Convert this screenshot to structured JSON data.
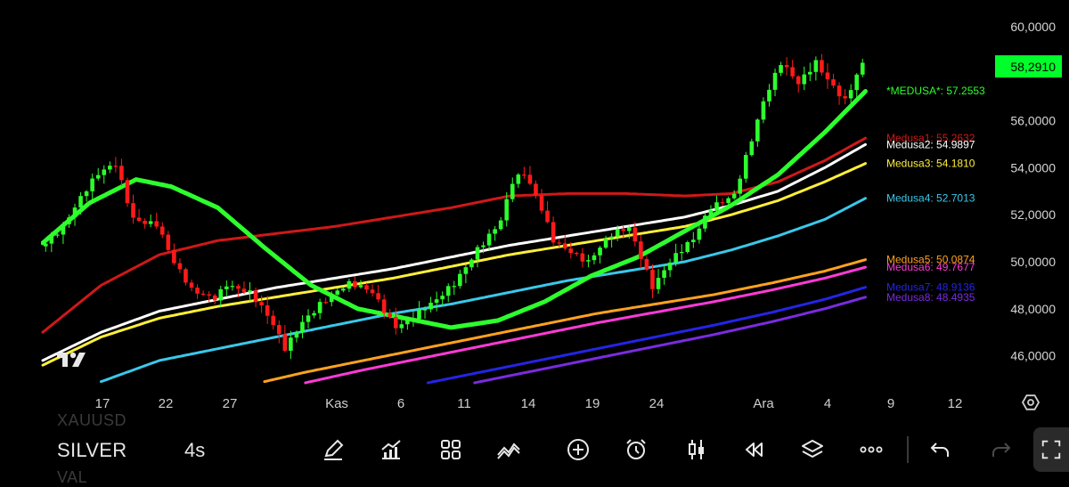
{
  "chart_data": {
    "type": "candlestick",
    "instrument": "SILVER",
    "ylim": [
      44.8,
      60.6
    ],
    "y_ticks": [
      "60,0000",
      "56,0000",
      "54,0000",
      "52,0000",
      "50,0000",
      "48,0000",
      "46,0000"
    ],
    "y_tick_values": [
      60,
      56,
      54,
      52,
      50,
      48,
      46
    ],
    "x_ticks": [
      "17",
      "22",
      "27",
      "Kas",
      "6",
      "11",
      "14",
      "19",
      "24",
      "Ara",
      "4",
      "9",
      "12"
    ],
    "current_price": {
      "label": "58,2910",
      "value": 58.291,
      "color": "#00ff2a"
    },
    "price_path": [
      {
        "bar": 0,
        "value": 50.8
      },
      {
        "bar": 4,
        "value": 51.6
      },
      {
        "bar": 10,
        "value": 53.6
      },
      {
        "bar": 13,
        "value": 54.2
      },
      {
        "bar": 16,
        "value": 52.0
      },
      {
        "bar": 20,
        "value": 51.6
      },
      {
        "bar": 23,
        "value": 49.8
      },
      {
        "bar": 26,
        "value": 48.7
      },
      {
        "bar": 30,
        "value": 48.6
      },
      {
        "bar": 32,
        "value": 49.2
      },
      {
        "bar": 36,
        "value": 48.6
      },
      {
        "bar": 40,
        "value": 47.2
      },
      {
        "bar": 42,
        "value": 46.3
      },
      {
        "bar": 45,
        "value": 47.6
      },
      {
        "bar": 48,
        "value": 48.3
      },
      {
        "bar": 53,
        "value": 48.9
      },
      {
        "bar": 57,
        "value": 48.7
      },
      {
        "bar": 61,
        "value": 47.4
      },
      {
        "bar": 64,
        "value": 47.7
      },
      {
        "bar": 68,
        "value": 48.2
      },
      {
        "bar": 71,
        "value": 49.0
      },
      {
        "bar": 75,
        "value": 50.7
      },
      {
        "bar": 79,
        "value": 51.8
      },
      {
        "bar": 81,
        "value": 53.3
      },
      {
        "bar": 83,
        "value": 53.6
      },
      {
        "bar": 86,
        "value": 52.2
      },
      {
        "bar": 88,
        "value": 51.0
      },
      {
        "bar": 91,
        "value": 50.6
      },
      {
        "bar": 94,
        "value": 50.0
      },
      {
        "bar": 98,
        "value": 51.0
      },
      {
        "bar": 101,
        "value": 51.4
      },
      {
        "bar": 103,
        "value": 50.3
      },
      {
        "bar": 105,
        "value": 49.1
      },
      {
        "bar": 108,
        "value": 50.1
      },
      {
        "bar": 112,
        "value": 50.8
      },
      {
        "bar": 115,
        "value": 52.2
      },
      {
        "bar": 119,
        "value": 53.0
      },
      {
        "bar": 121,
        "value": 54.6
      },
      {
        "bar": 124,
        "value": 56.8
      },
      {
        "bar": 127,
        "value": 58.3
      },
      {
        "bar": 130,
        "value": 57.5
      },
      {
        "bar": 133,
        "value": 58.6
      },
      {
        "bar": 136,
        "value": 57.6
      },
      {
        "bar": 138,
        "value": 56.9
      },
      {
        "bar": 141,
        "value": 58.3
      }
    ],
    "series": [
      {
        "name": "*MEDUSA*",
        "label": "*MEDUSA*: 57.2553",
        "last": 57.2553,
        "color": "#2dff2d",
        "points": [
          [
            0,
            50.8
          ],
          [
            8,
            52.5
          ],
          [
            16,
            53.5
          ],
          [
            22,
            53.2
          ],
          [
            30,
            52.3
          ],
          [
            38,
            50.6
          ],
          [
            46,
            49.0
          ],
          [
            54,
            48.0
          ],
          [
            62,
            47.6
          ],
          [
            70,
            47.2
          ],
          [
            78,
            47.5
          ],
          [
            86,
            48.3
          ],
          [
            94,
            49.4
          ],
          [
            102,
            50.2
          ],
          [
            110,
            51.3
          ],
          [
            118,
            52.4
          ],
          [
            126,
            53.7
          ],
          [
            134,
            55.5
          ],
          [
            141,
            57.2553
          ]
        ]
      },
      {
        "name": "Medusa1",
        "label": "Medusa1: 55.2632",
        "last": 55.2632,
        "color": "#d01818",
        "points": [
          [
            0,
            47.0
          ],
          [
            10,
            49.0
          ],
          [
            20,
            50.3
          ],
          [
            30,
            50.9
          ],
          [
            40,
            51.2
          ],
          [
            50,
            51.5
          ],
          [
            60,
            51.9
          ],
          [
            70,
            52.3
          ],
          [
            80,
            52.8
          ],
          [
            90,
            52.9
          ],
          [
            100,
            52.9
          ],
          [
            110,
            52.8
          ],
          [
            118,
            52.9
          ],
          [
            126,
            53.4
          ],
          [
            134,
            54.3
          ],
          [
            141,
            55.2632
          ]
        ]
      },
      {
        "name": "Medusa2",
        "label": "Medusa2: 54.9897",
        "last": 54.9897,
        "color": "#ffffff",
        "points": [
          [
            0,
            45.8
          ],
          [
            10,
            47.0
          ],
          [
            20,
            47.9
          ],
          [
            30,
            48.4
          ],
          [
            40,
            48.9
          ],
          [
            50,
            49.3
          ],
          [
            60,
            49.7
          ],
          [
            70,
            50.2
          ],
          [
            80,
            50.7
          ],
          [
            90,
            51.1
          ],
          [
            100,
            51.5
          ],
          [
            110,
            51.9
          ],
          [
            118,
            52.4
          ],
          [
            126,
            53.0
          ],
          [
            134,
            54.0
          ],
          [
            141,
            54.9897
          ]
        ]
      },
      {
        "name": "Medusa3",
        "label": "Medusa3: 54.1810",
        "last": 54.181,
        "color": "#ffef3a",
        "points": [
          [
            0,
            45.6
          ],
          [
            10,
            46.8
          ],
          [
            20,
            47.6
          ],
          [
            30,
            48.1
          ],
          [
            40,
            48.5
          ],
          [
            50,
            48.9
          ],
          [
            60,
            49.3
          ],
          [
            70,
            49.8
          ],
          [
            80,
            50.3
          ],
          [
            90,
            50.7
          ],
          [
            100,
            51.1
          ],
          [
            110,
            51.5
          ],
          [
            118,
            52.0
          ],
          [
            126,
            52.6
          ],
          [
            134,
            53.4
          ],
          [
            141,
            54.181
          ]
        ]
      },
      {
        "name": "Medusa4",
        "label": "Medusa4: 52.7013",
        "last": 52.7013,
        "color": "#3ac8ea",
        "points": [
          [
            10,
            44.9
          ],
          [
            20,
            45.8
          ],
          [
            30,
            46.3
          ],
          [
            40,
            46.8
          ],
          [
            50,
            47.3
          ],
          [
            60,
            47.8
          ],
          [
            70,
            48.2
          ],
          [
            80,
            48.7
          ],
          [
            90,
            49.2
          ],
          [
            100,
            49.6
          ],
          [
            110,
            50.0
          ],
          [
            118,
            50.5
          ],
          [
            126,
            51.1
          ],
          [
            134,
            51.8
          ],
          [
            141,
            52.7013
          ]
        ]
      },
      {
        "name": "Medusa5",
        "label": "Medusa5: 50.0874",
        "last": 50.0874,
        "color": "#ffa21f",
        "points": [
          [
            38,
            44.9
          ],
          [
            45,
            45.3
          ],
          [
            55,
            45.8
          ],
          [
            65,
            46.3
          ],
          [
            75,
            46.8
          ],
          [
            85,
            47.3
          ],
          [
            95,
            47.8
          ],
          [
            105,
            48.2
          ],
          [
            115,
            48.6
          ],
          [
            125,
            49.1
          ],
          [
            134,
            49.6
          ],
          [
            141,
            50.0874
          ]
        ]
      },
      {
        "name": "Medusa6",
        "label": "Medusa6: 49.7677",
        "last": 49.7677,
        "color": "#ff3ad8",
        "points": [
          [
            45,
            44.85
          ],
          [
            55,
            45.4
          ],
          [
            65,
            45.9
          ],
          [
            75,
            46.4
          ],
          [
            85,
            46.9
          ],
          [
            95,
            47.4
          ],
          [
            105,
            47.85
          ],
          [
            115,
            48.3
          ],
          [
            125,
            48.8
          ],
          [
            134,
            49.3
          ],
          [
            141,
            49.7677
          ]
        ]
      },
      {
        "name": "Medusa7",
        "label": "Medusa7: 48.9136",
        "last": 48.9136,
        "color": "#2424e6",
        "points": [
          [
            66,
            44.85
          ],
          [
            75,
            45.3
          ],
          [
            85,
            45.8
          ],
          [
            95,
            46.3
          ],
          [
            105,
            46.8
          ],
          [
            115,
            47.3
          ],
          [
            125,
            47.85
          ],
          [
            134,
            48.4
          ],
          [
            141,
            48.9136
          ]
        ]
      },
      {
        "name": "Medusa8",
        "label": "Medusa8: 48.4935",
        "last": 48.4935,
        "color": "#7a2be0",
        "points": [
          [
            74,
            44.85
          ],
          [
            85,
            45.4
          ],
          [
            95,
            45.9
          ],
          [
            105,
            46.4
          ],
          [
            115,
            46.9
          ],
          [
            125,
            47.45
          ],
          [
            134,
            48.0
          ],
          [
            141,
            48.4935
          ]
        ]
      }
    ]
  },
  "toolbar": {
    "symbol": "SILVER",
    "symbol_above": "XAUUSD",
    "symbol_below": "VAL",
    "interval": "4s",
    "icons": [
      "pencil-icon",
      "indicators-icon",
      "templates-icon",
      "compare-icon",
      "add-icon",
      "alarm-icon",
      "chart-type-icon",
      "replay-icon",
      "layers-icon",
      "more-icon",
      "undo-icon",
      "redo-icon",
      "fullscreen-icon"
    ]
  }
}
